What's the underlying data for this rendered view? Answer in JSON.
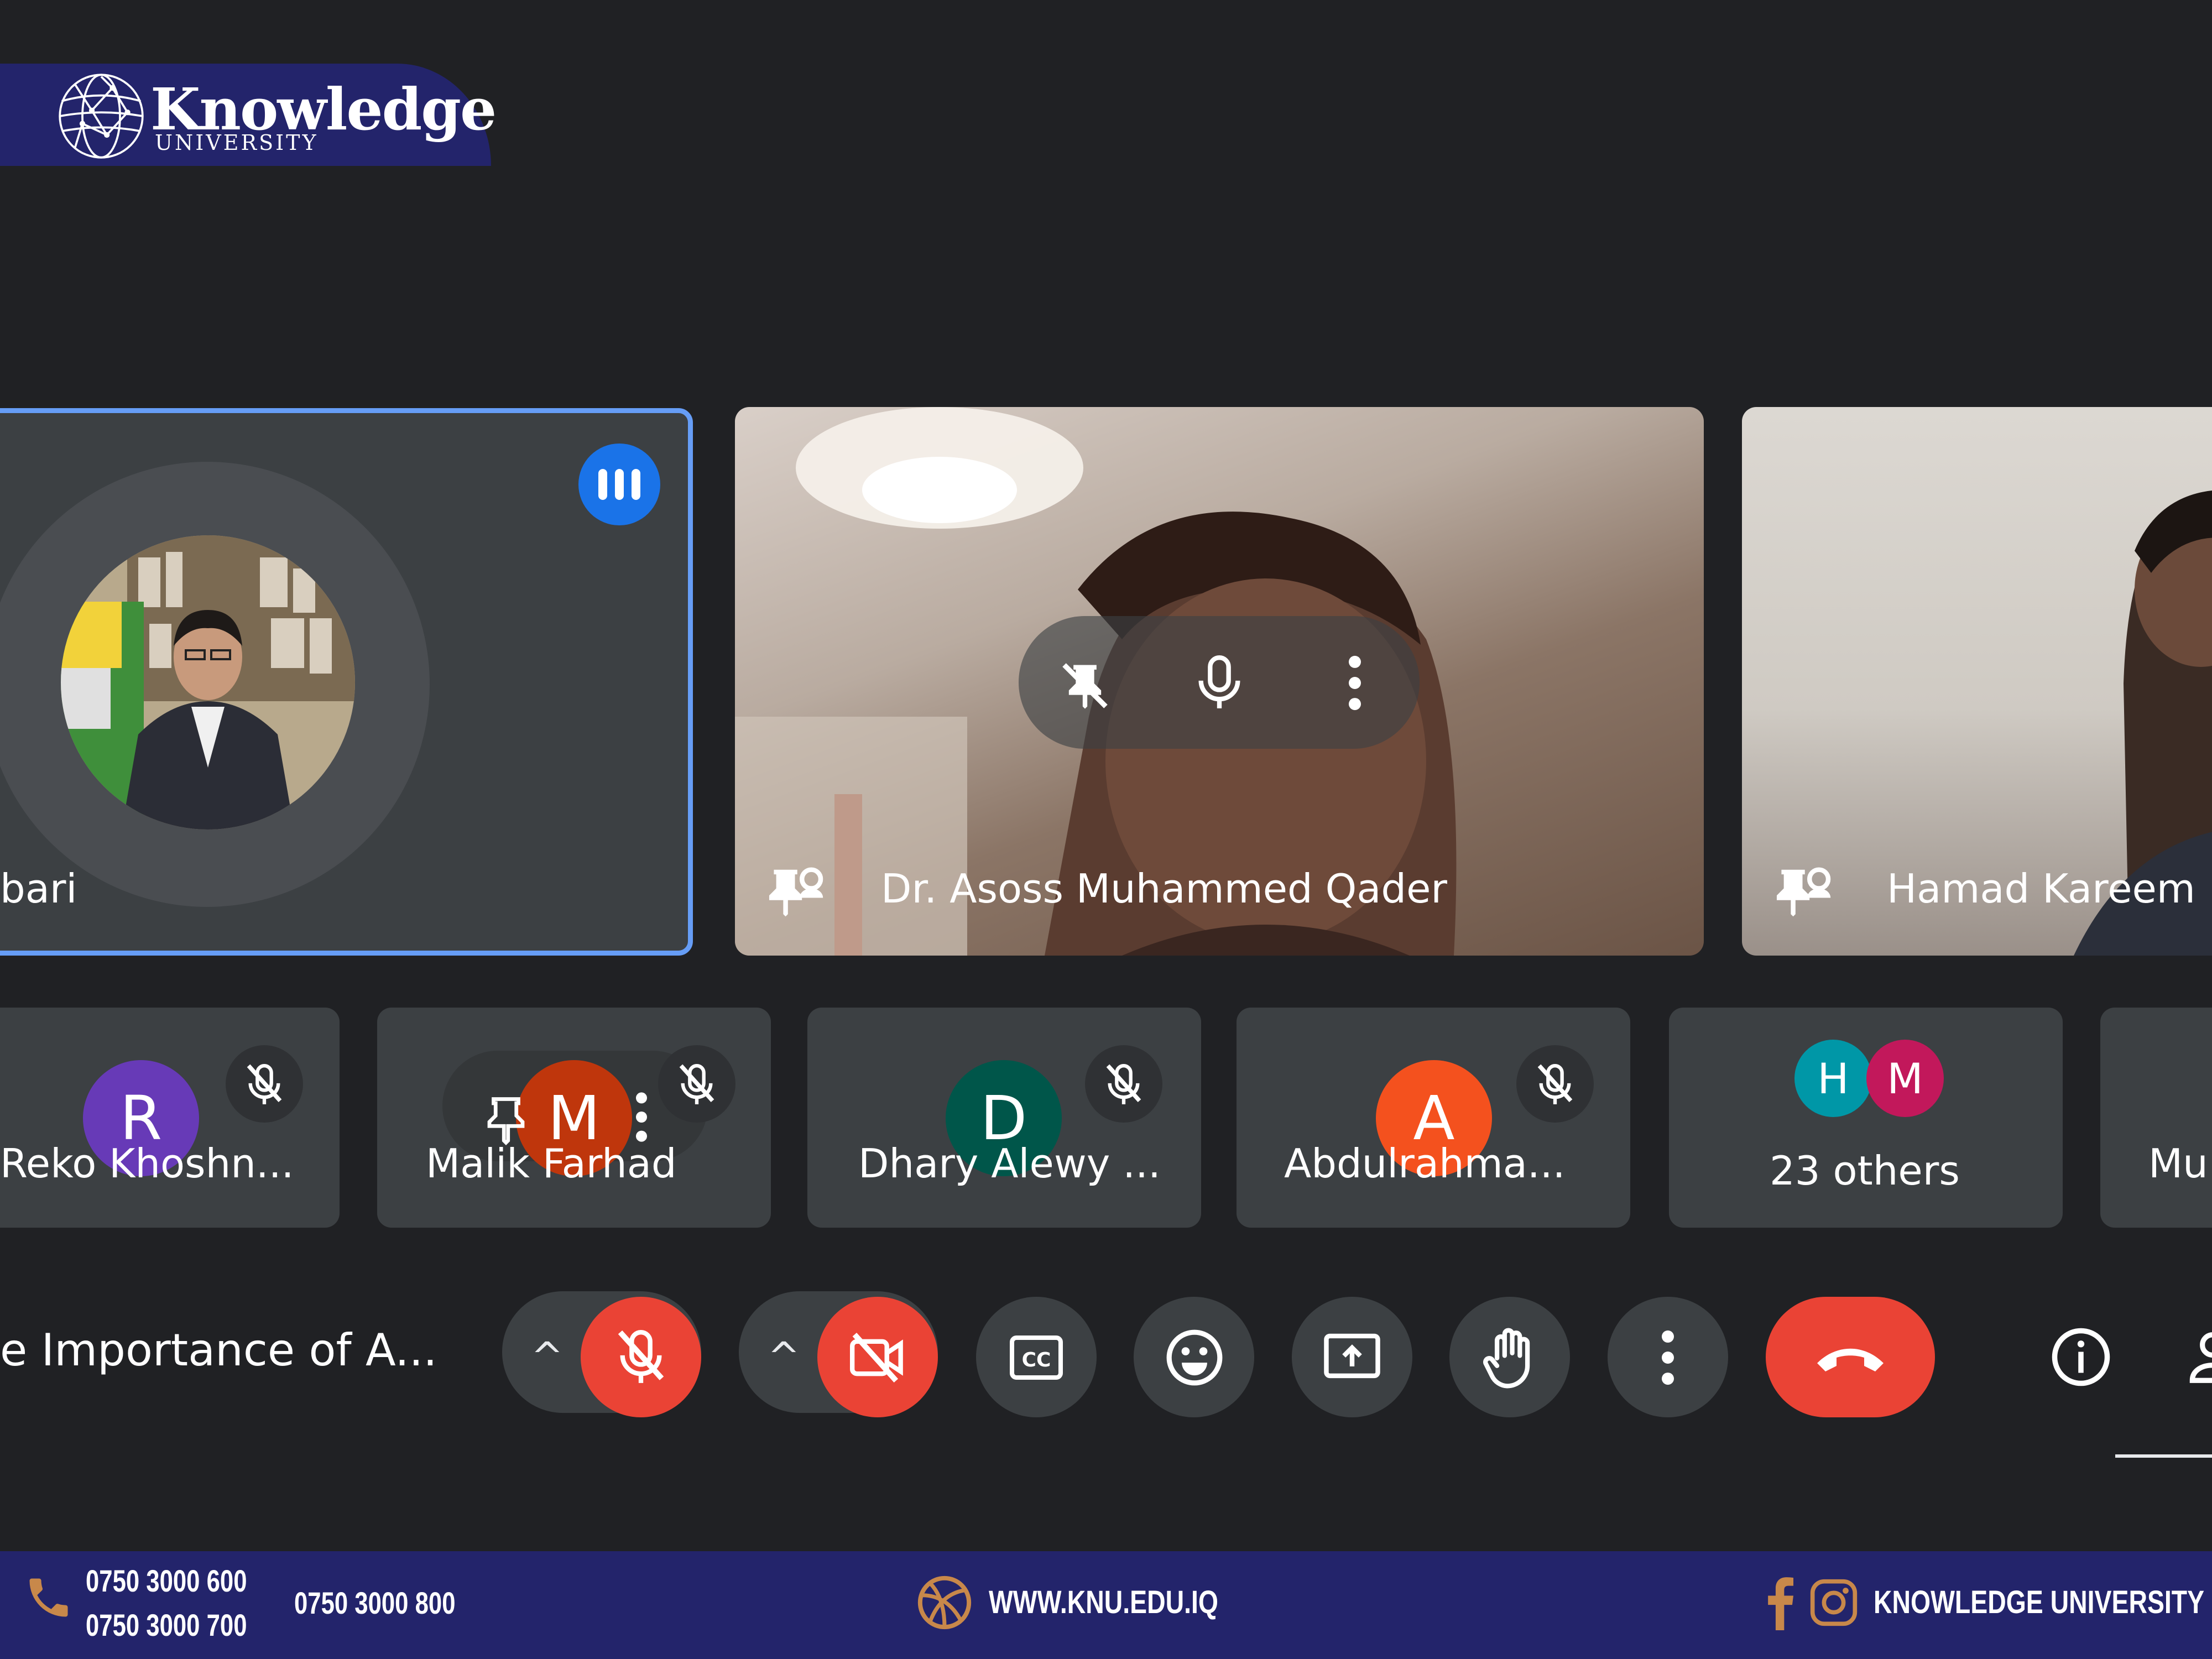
{
  "branding": {
    "title": "Knowledge",
    "subtitle": "UNIVERSITY"
  },
  "main_tiles": [
    {
      "name": "bari",
      "speaking": true
    },
    {
      "name": "Dr. Asoss Muhammed Qader",
      "hover_actions": [
        "pin-off-icon",
        "microphone-icon",
        "more-vert-icon"
      ]
    },
    {
      "name": "Hamad Kareem"
    }
  ],
  "participants": [
    {
      "initial": "R",
      "name": "Reko Khoshn...",
      "color": "#673ab7",
      "muted": true
    },
    {
      "initial": "M",
      "name": "Malik Farhad",
      "color": "#bf360c",
      "muted": true
    },
    {
      "initial": "D",
      "name": "Dhary Alewy ...",
      "color": "#00564a",
      "muted": true
    },
    {
      "initial": "A",
      "name": "Abdulrahma...",
      "color": "#f4511e",
      "muted": true
    }
  ],
  "others": {
    "initials": [
      "H",
      "M"
    ],
    "colors": [
      "#0097a7",
      "#c2185b"
    ],
    "label": "23 others"
  },
  "partial_tile_name": "Mu",
  "meeting_title": "e Importance of A...",
  "colors": {
    "background": "#202124",
    "tile": "#3c4043",
    "accent_blue": "#1a73e8",
    "active_border": "#669df6",
    "danger_red": "#ea4335",
    "brand_navy": "#23246b",
    "brand_gold": "#c8884a"
  },
  "footer": {
    "phone_1": "0750 3000 600",
    "phone_2": "0750 3000 700",
    "phone_3": "0750 3000 800",
    "website": "WWW.KNU.EDU.IQ",
    "social_name": "KNOWLEDGE UNIVERSITY"
  }
}
